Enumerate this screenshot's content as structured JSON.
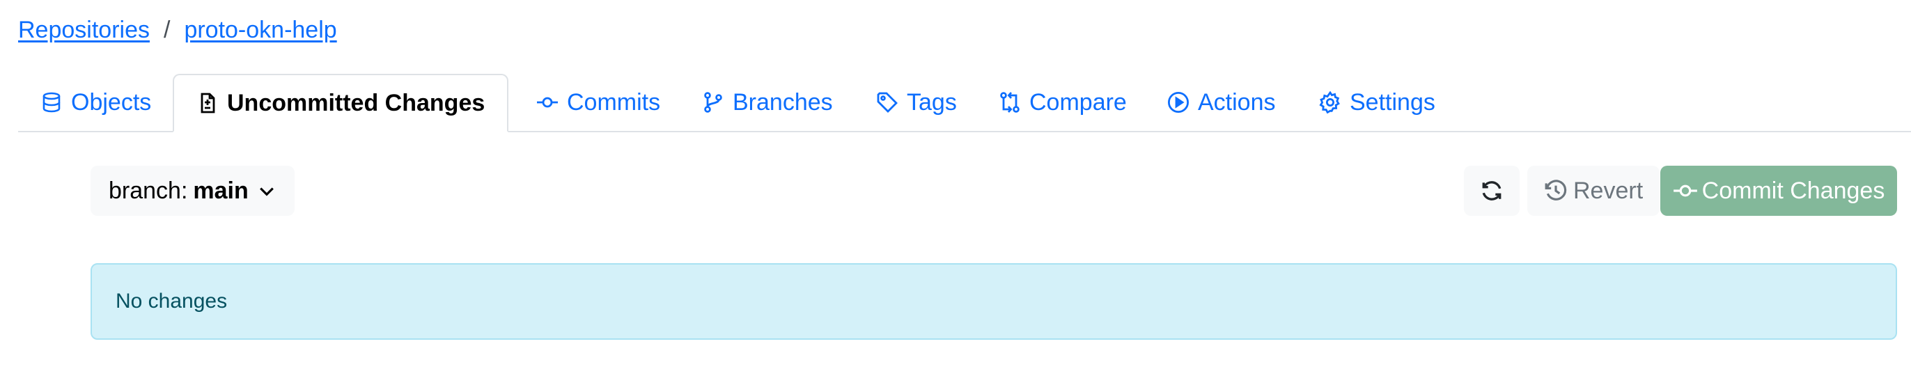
{
  "breadcrumb": {
    "repositories": "Repositories",
    "separator": "/",
    "repo": "proto-okn-help"
  },
  "tabs": [
    {
      "label": "Objects",
      "icon": "database-icon",
      "active": false
    },
    {
      "label": "Uncommitted Changes",
      "icon": "file-diff-icon",
      "active": true
    },
    {
      "label": "Commits",
      "icon": "git-commit-icon",
      "active": false
    },
    {
      "label": "Branches",
      "icon": "git-branch-icon",
      "active": false
    },
    {
      "label": "Tags",
      "icon": "tag-icon",
      "active": false
    },
    {
      "label": "Compare",
      "icon": "git-compare-icon",
      "active": false
    },
    {
      "label": "Actions",
      "icon": "play-icon",
      "active": false
    },
    {
      "label": "Settings",
      "icon": "gear-icon",
      "active": false
    }
  ],
  "toolbar": {
    "branch_prefix": "branch:",
    "branch_name": "main",
    "revert_label": "Revert",
    "commit_label": "Commit Changes"
  },
  "status": {
    "message": "No changes"
  },
  "colors": {
    "link": "#0d6efd",
    "commit_button": "#83b89a",
    "alert_bg": "#d4f1f9",
    "alert_border": "#a9e2f2"
  }
}
